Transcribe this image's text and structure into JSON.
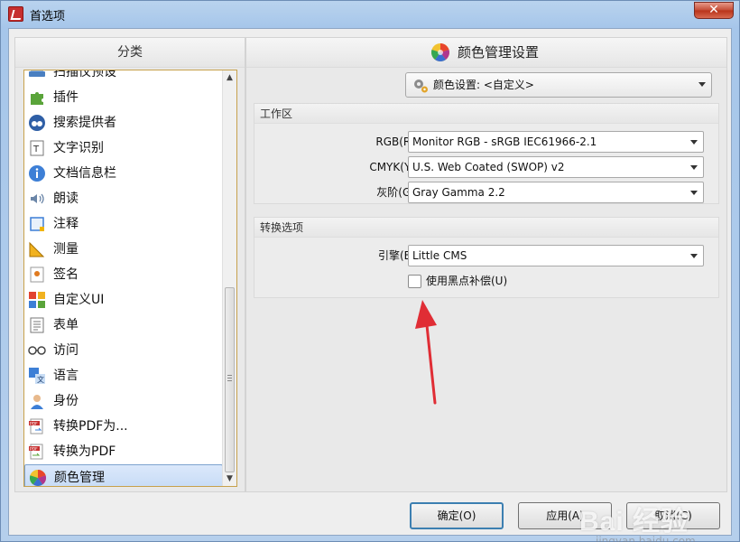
{
  "window": {
    "title": "首选项",
    "close_symbol": "✕"
  },
  "categories": {
    "header": "分类",
    "items": [
      {
        "label": "扫描仪预设",
        "icon": "scanner-icon"
      },
      {
        "label": "插件",
        "icon": "puzzle-icon"
      },
      {
        "label": "搜索提供者",
        "icon": "binoculars-icon"
      },
      {
        "label": "文字识别",
        "icon": "ocr-text-icon"
      },
      {
        "label": "文档信息栏",
        "icon": "info-icon"
      },
      {
        "label": "朗读",
        "icon": "speaker-icon"
      },
      {
        "label": "注释",
        "icon": "annotation-icon"
      },
      {
        "label": "测量",
        "icon": "ruler-triangle-icon"
      },
      {
        "label": "签名",
        "icon": "signature-icon"
      },
      {
        "label": "自定义UI",
        "icon": "customize-ui-icon"
      },
      {
        "label": "表单",
        "icon": "form-icon"
      },
      {
        "label": "访问",
        "icon": "glasses-icon"
      },
      {
        "label": "语言",
        "icon": "language-icon"
      },
      {
        "label": "身份",
        "icon": "identity-icon"
      },
      {
        "label": "转换PDF为...",
        "icon": "pdf-convert-from-icon"
      },
      {
        "label": "转换为PDF",
        "icon": "pdf-convert-to-icon"
      },
      {
        "label": "颜色管理",
        "icon": "color-wheel-icon",
        "selected": true
      }
    ]
  },
  "settings": {
    "header": "颜色管理设置",
    "profile": "颜色设置: <自定义>",
    "workspace": {
      "title": "工作区",
      "rgb_label": "RGB(R):",
      "rgb_value": "Monitor RGB - sRGB IEC61966-2.1",
      "cmyk_label": "CMYK(Y):",
      "cmyk_value": "U.S. Web Coated (SWOP) v2",
      "gray_label": "灰阶(G):",
      "gray_value": "Gray Gamma 2.2"
    },
    "conversion": {
      "title": "转换选项",
      "engine_label": "引擎(E):",
      "engine_value": "Little CMS",
      "blackpoint_label": "使用黑点补偿(U)",
      "blackpoint_checked": false
    }
  },
  "buttons": {
    "ok": "确定(O)",
    "apply": "应用(A)",
    "cancel": "取消(C)"
  },
  "watermark": {
    "main": "Bai 经验",
    "sub": "jingyan.baidu.com"
  },
  "colors": {
    "accent": "#3c7fb1",
    "annotation_arrow": "#e02d35",
    "selection": "#c6dbf6"
  }
}
